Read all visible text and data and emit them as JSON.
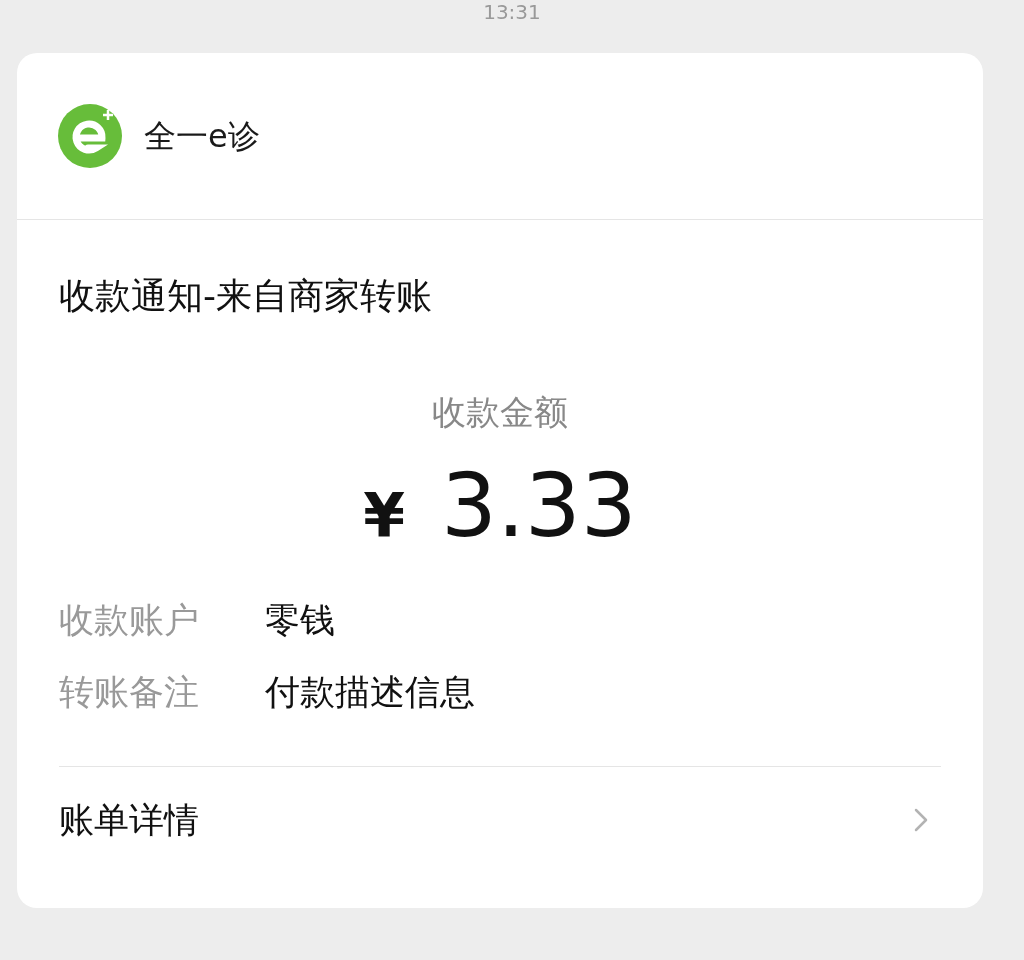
{
  "time": "13:31",
  "merchant": {
    "name": "全一e诊"
  },
  "title": "收款通知-来自商家转账",
  "amount": {
    "label": "收款金额",
    "currency": "¥",
    "value": "3.33"
  },
  "fields": [
    {
      "label": "收款账户",
      "value": "零钱"
    },
    {
      "label": "转账备注",
      "value": "付款描述信息"
    }
  ],
  "details_link": {
    "label": "账单详情"
  }
}
